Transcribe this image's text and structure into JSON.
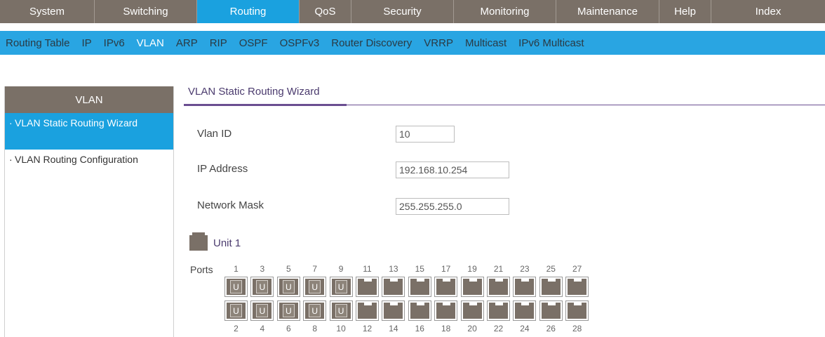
{
  "top_menu": [
    {
      "label": "System",
      "active": false
    },
    {
      "label": "Switching",
      "active": false
    },
    {
      "label": "Routing",
      "active": true
    },
    {
      "label": "QoS",
      "active": false
    },
    {
      "label": "Security",
      "active": false
    },
    {
      "label": "Monitoring",
      "active": false
    },
    {
      "label": "Maintenance",
      "active": false
    },
    {
      "label": "Help",
      "active": false
    },
    {
      "label": "Index",
      "active": false
    }
  ],
  "sub_menu": [
    {
      "label": "Routing Table",
      "active": false
    },
    {
      "label": "IP",
      "active": false
    },
    {
      "label": "IPv6",
      "active": false
    },
    {
      "label": "VLAN",
      "active": true
    },
    {
      "label": "ARP",
      "active": false
    },
    {
      "label": "RIP",
      "active": false
    },
    {
      "label": "OSPF",
      "active": false
    },
    {
      "label": "OSPFv3",
      "active": false
    },
    {
      "label": "Router Discovery",
      "active": false
    },
    {
      "label": "VRRP",
      "active": false
    },
    {
      "label": "Multicast",
      "active": false
    },
    {
      "label": "IPv6 Multicast",
      "active": false
    }
  ],
  "sidebar": {
    "title": "VLAN",
    "items": [
      {
        "label": "VLAN Static Routing Wizard",
        "active": true
      },
      {
        "label": "VLAN Routing Configuration",
        "active": false
      }
    ]
  },
  "main": {
    "title": "VLAN Static Routing Wizard",
    "fields": {
      "vlan_id": {
        "label": "Vlan ID",
        "value": "10"
      },
      "ip_address": {
        "label": "IP Address",
        "value": "192.168.10.254"
      },
      "network_mask": {
        "label": "Network Mask",
        "value": "255.255.255.0"
      }
    },
    "unit_label": "Unit 1",
    "ports_label": "Ports",
    "ports_top": [
      {
        "num": "1",
        "u": true
      },
      {
        "num": "3",
        "u": true
      },
      {
        "num": "5",
        "u": true
      },
      {
        "num": "7",
        "u": true
      },
      {
        "num": "9",
        "u": true
      },
      {
        "num": "11",
        "u": false
      },
      {
        "num": "13",
        "u": false
      },
      {
        "num": "15",
        "u": false
      },
      {
        "num": "17",
        "u": false
      },
      {
        "num": "19",
        "u": false
      },
      {
        "num": "21",
        "u": false
      },
      {
        "num": "23",
        "u": false
      },
      {
        "num": "25",
        "u": false
      },
      {
        "num": "27",
        "u": false
      }
    ],
    "ports_bottom": [
      {
        "num": "2",
        "u": true
      },
      {
        "num": "4",
        "u": true
      },
      {
        "num": "6",
        "u": true
      },
      {
        "num": "8",
        "u": true
      },
      {
        "num": "10",
        "u": true
      },
      {
        "num": "12",
        "u": false
      },
      {
        "num": "14",
        "u": false
      },
      {
        "num": "16",
        "u": false
      },
      {
        "num": "18",
        "u": false
      },
      {
        "num": "20",
        "u": false
      },
      {
        "num": "22",
        "u": false
      },
      {
        "num": "24",
        "u": false
      },
      {
        "num": "26",
        "u": false
      },
      {
        "num": "28",
        "u": false
      }
    ],
    "port_tag_letter": "U"
  },
  "colors": {
    "nav_bg": "#7a7067",
    "accent": "#1aa1df",
    "subnav_bg": "#29a5e2",
    "title_purple": "#6a4e91"
  }
}
